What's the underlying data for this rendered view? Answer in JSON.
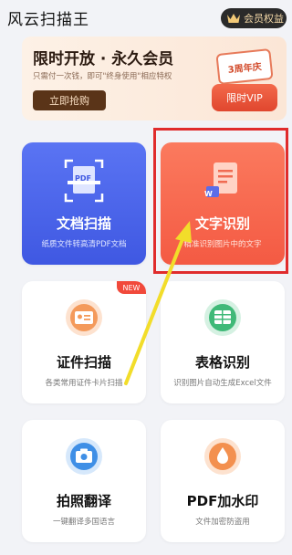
{
  "header": {
    "app_title": "风云扫描王",
    "vip_rights": "会员权益"
  },
  "banner": {
    "title": "限时开放 · 永久会员",
    "subtitle": "只需付一次钱，即可\"终身使用\"相应特权",
    "buy_button": "立即抢购",
    "card_ribbon": "3周年庆",
    "card_label": "限时VIP"
  },
  "tools": [
    {
      "title": "文档扫描",
      "desc": "纸质文件转高清PDF文档",
      "icon": "document-scan-icon"
    },
    {
      "title": "文字识别",
      "desc": "精准识别图片中的文字",
      "icon": "text-recognition-icon"
    },
    {
      "title": "证件扫描",
      "desc": "各类常用证件卡片扫描",
      "icon": "id-card-icon",
      "badge": "NEW"
    },
    {
      "title": "表格识别",
      "desc": "识别图片自动生成Excel文件",
      "icon": "table-icon"
    },
    {
      "title": "拍照翻译",
      "desc": "一键翻译多国语言",
      "icon": "camera-translate-icon"
    },
    {
      "title": "PDF加水印",
      "desc": "文件加密防盗用",
      "icon": "watermark-icon"
    }
  ],
  "icon_labels": {
    "pdf": "PDF",
    "word": "W"
  },
  "colors": {
    "highlight": "#e02c2c",
    "arrow": "#f2dd2a",
    "blue_card": "#4a64ea",
    "red_card": "#f7674e"
  }
}
